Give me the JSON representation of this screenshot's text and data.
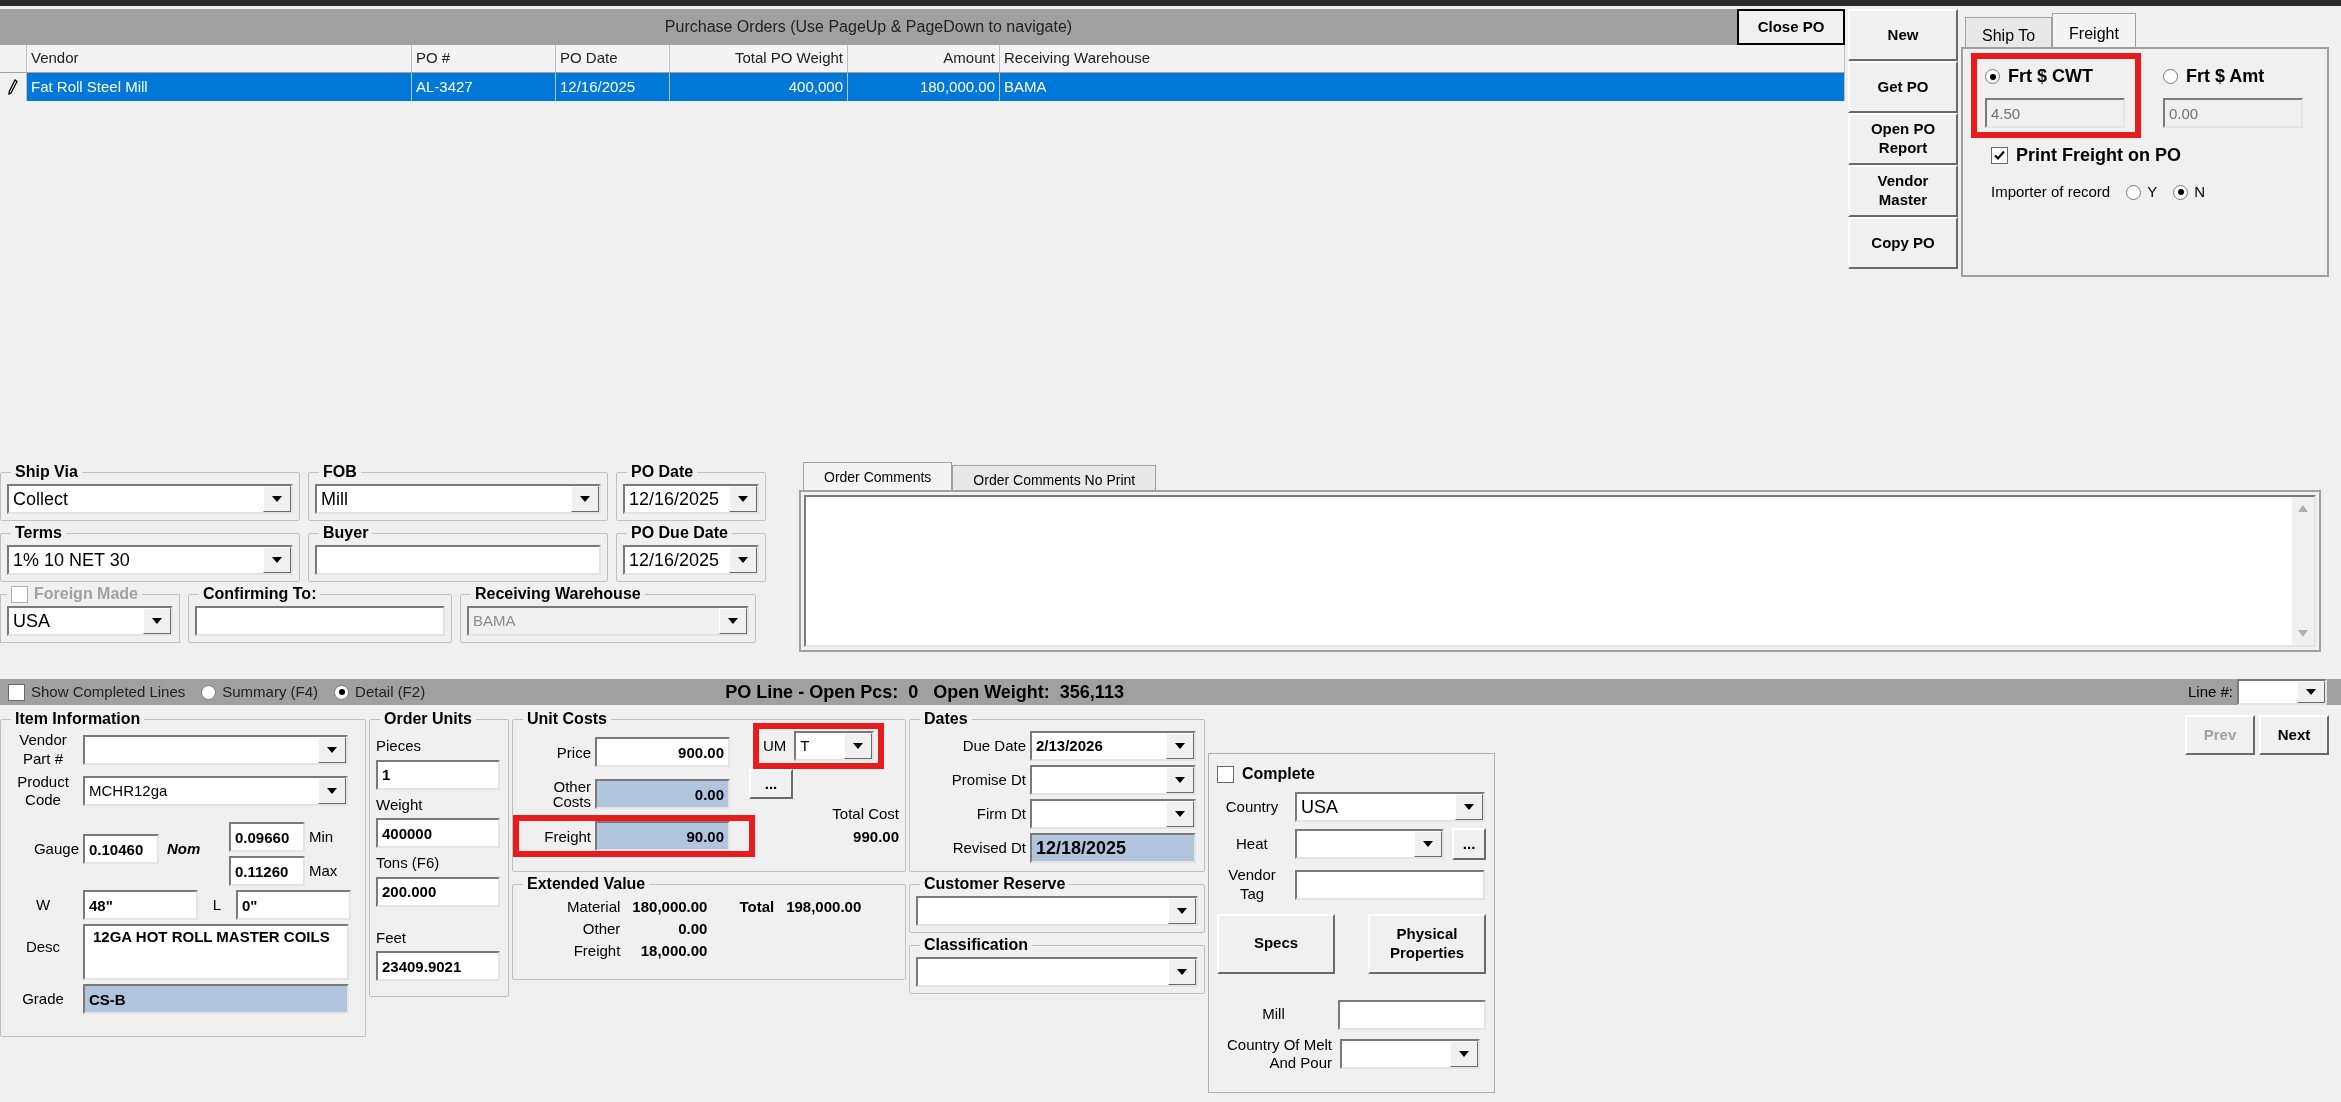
{
  "purchase_orders": {
    "title": "Purchase Orders (Use PageUp & PageDown to navigate)",
    "close_button": "Close PO",
    "columns": [
      "Vendor",
      "PO #",
      "PO Date",
      "Total PO Weight",
      "Amount",
      "Receiving Warehouse"
    ],
    "rows": [
      {
        "selected": true,
        "editing": true,
        "cells": [
          "Fat Roll Steel Mill",
          "AL-3427",
          "12/16/2025",
          "400,000",
          "180,000.00",
          "BAMA"
        ]
      }
    ]
  },
  "side_buttons": [
    "New",
    "Get PO",
    "Open PO Report",
    "Vendor Master",
    "Copy PO"
  ],
  "freight_panel": {
    "tabs": [
      {
        "label": "Ship To",
        "selected": false
      },
      {
        "label": "Freight",
        "selected": true
      }
    ],
    "rate_options": [
      {
        "label": "Frt $ CWT",
        "selected": true,
        "value": "4.50",
        "disabled": true,
        "highlighted": true
      },
      {
        "label": "Frt $ Amt",
        "selected": false,
        "value": "0.00",
        "disabled": true,
        "highlighted": false
      }
    ],
    "print_freight": {
      "label": "Print Freight on PO",
      "checked": true
    },
    "importer": {
      "label": "Importer of record",
      "options": [
        {
          "label": "Y",
          "selected": false
        },
        {
          "label": "N",
          "selected": true
        }
      ]
    }
  },
  "header_fields": {
    "ship_via": {
      "label": "Ship Via",
      "value": "Collect"
    },
    "fob": {
      "label": "FOB",
      "value": "Mill"
    },
    "po_date": {
      "label": "PO Date",
      "value": "12/16/2025"
    },
    "terms": {
      "label": "Terms",
      "value": "1% 10 NET 30"
    },
    "buyer": {
      "label": "Buyer"
    },
    "po_due_date": {
      "label": "PO Due Date",
      "value": "12/16/2025"
    },
    "foreign_made": {
      "label": "Foreign Made",
      "checked": false,
      "disabled": true,
      "value": "USA"
    },
    "confirming_to": {
      "label": "Confirming To:"
    },
    "receiving_warehouse": {
      "label": "Receiving Warehouse",
      "value": "BAMA",
      "disabled": true
    }
  },
  "comments": {
    "tabs": [
      {
        "label": "Order Comments",
        "selected": true
      },
      {
        "label": "Order Comments No Print",
        "selected": false
      }
    ]
  },
  "line_bar": {
    "show_completed": {
      "label": "Show Completed Lines",
      "checked": false
    },
    "view_options": [
      {
        "label": "Summary (F4)",
        "selected": false
      },
      {
        "label": "Detail (F2)",
        "selected": true
      }
    ],
    "status": "PO Line - Open Pcs:  0   Open Weight:  356,113",
    "line_number_label": "Line #:"
  },
  "item_information": {
    "title": "Item Information",
    "vendor_part": {
      "label": "Vendor Part #"
    },
    "product_code": {
      "label": "Product Code",
      "value": "MCHR12ga"
    },
    "gauge": {
      "label": "Gauge",
      "value": "0.10460",
      "nominal_label": "Nom",
      "min_value": "0.09660",
      "min_label": "Min",
      "max_value": "0.11260",
      "max_label": "Max"
    },
    "width": {
      "label": "W",
      "value": "48\""
    },
    "length": {
      "label": "L",
      "value": "0\""
    },
    "desc": {
      "label": "Desc",
      "value": "12GA HOT ROLL MASTER COILS"
    },
    "grade": {
      "label": "Grade",
      "value": "CS-B",
      "locked": true
    }
  },
  "order_units": {
    "title": "Order Units",
    "fields": [
      {
        "label": "Pieces",
        "value": "1"
      },
      {
        "label": "Weight",
        "value": "400000"
      },
      {
        "label": "Tons (F6)",
        "value": "200.000"
      },
      {
        "label": "Feet",
        "value": "23409.9021"
      }
    ]
  },
  "unit_costs": {
    "title": "Unit Costs",
    "fields": [
      {
        "label": "Price",
        "value": "900.00",
        "locked": false,
        "highlighted": false
      },
      {
        "label": "Other Costs",
        "value": "0.00",
        "locked": true,
        "highlighted": false
      },
      {
        "label": "Freight",
        "value": "90.00",
        "locked": true,
        "highlighted": true
      }
    ],
    "um": {
      "label": "UM",
      "value": "T",
      "highlighted": true
    },
    "more_button": "...",
    "total_cost_label": "Total Cost",
    "total_cost": "990.00"
  },
  "extended_value": {
    "title": "Extended Value",
    "rows": [
      {
        "label": "Material",
        "value": "180,000.00"
      },
      {
        "label": "Other",
        "value": "0.00"
      },
      {
        "label": "Freight",
        "value": "18,000.00"
      }
    ],
    "total_label": "Total",
    "total": "198,000.00"
  },
  "dates": {
    "title": "Dates",
    "fields": [
      {
        "label": "Due Date",
        "value": "2/13/2026",
        "kind": "combo"
      },
      {
        "label": "Promise Dt",
        "kind": "combo"
      },
      {
        "label": "Firm Dt",
        "kind": "combo"
      },
      {
        "label": "Revised Dt",
        "value": "12/18/2025",
        "kind": "locked"
      }
    ]
  },
  "customer_reserve": {
    "title": "Customer Reserve"
  },
  "classification": {
    "title": "Classification"
  },
  "complete_panel": {
    "complete": {
      "label": "Complete",
      "checked": false
    },
    "country": {
      "label": "Country",
      "value": "USA"
    },
    "heat": {
      "label": "Heat",
      "button": "..."
    },
    "vendor_tag": {
      "label": "Vendor Tag"
    },
    "buttons": [
      "Specs",
      "Physical Properties"
    ],
    "mill": {
      "label": "Mill"
    },
    "country_of_melt": {
      "label": "Country Of Melt And Pour"
    }
  },
  "nav_buttons": [
    {
      "label": "Prev",
      "disabled": true
    },
    {
      "label": "Next",
      "disabled": false
    }
  ]
}
